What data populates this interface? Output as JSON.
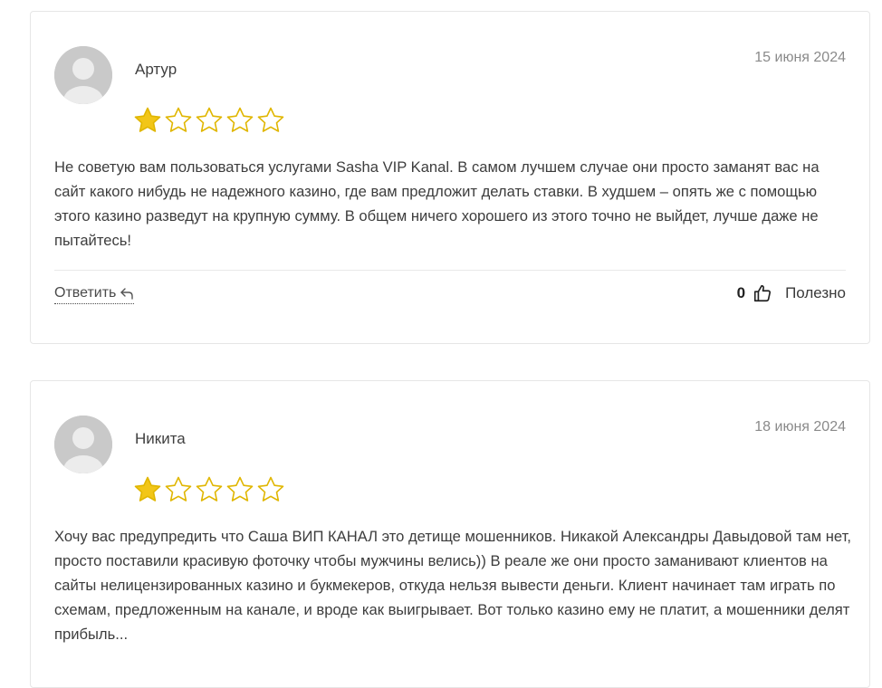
{
  "reviews": [
    {
      "author": "Артур",
      "date": "15 июня 2024",
      "rating": 1,
      "max_rating": 5,
      "text": "Не советую вам пользоваться услугами Sasha VIP Kanal. В самом лучшем случае они просто заманят вас на сайт какого нибудь не надежного казино, где вам предложит делать ставки. В худшем – опять же с помощью этого казино разведут на крупную сумму. В общем ничего хорошего из этого точно не выйдет, лучше даже не пытайтесь!",
      "reply_label": "Ответить",
      "likes": "0",
      "helpful_label": "Полезно"
    },
    {
      "author": "Никита",
      "date": "18 июня 2024",
      "rating": 1,
      "max_rating": 5,
      "text": "Хочу вас предупредить что Саша ВИП КАНАЛ это детище мошенников. Никакой Александры Давыдовой там нет, просто поставили красивую фоточку чтобы мужчины велись)) В реале же они просто заманивают клиентов на сайты нелицензированных казино и букмекеров, откуда нельзя вывести деньги. Клиент начинает там играть по схемам, предложенным на канале, и вроде как выигрывает. Вот только казино ему не платит, а мошенники делят прибыль..."
    }
  ],
  "colors": {
    "star_filled": "#f2c618",
    "star_outline": "#e0b600",
    "avatar_bg": "#c9c9c9",
    "avatar_fg": "#eeeeee"
  },
  "icons": {
    "star": "star-icon",
    "reply": "reply-arrow-icon",
    "like": "thumbs-up-icon",
    "avatar": "user-silhouette-icon"
  }
}
